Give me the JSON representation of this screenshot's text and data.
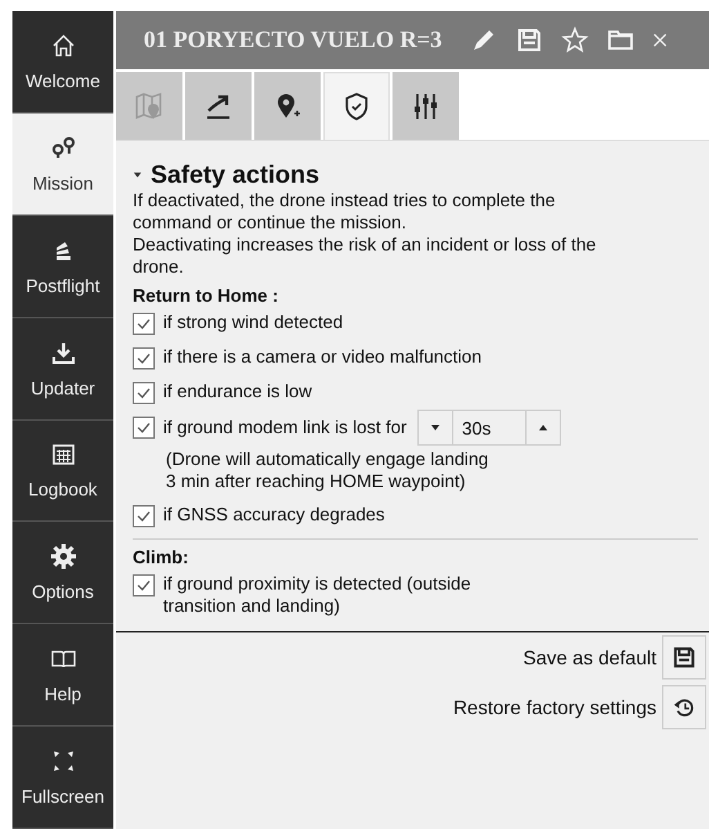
{
  "sidebar": {
    "items": [
      {
        "label": "Welcome",
        "selected": false
      },
      {
        "label": "Mission",
        "selected": true
      },
      {
        "label": "Postflight",
        "selected": false
      },
      {
        "label": "Updater",
        "selected": false
      },
      {
        "label": "Logbook",
        "selected": false
      },
      {
        "label": "Options",
        "selected": false
      },
      {
        "label": "Help",
        "selected": false
      },
      {
        "label": "Fullscreen",
        "selected": false
      }
    ]
  },
  "window": {
    "title": "01 PORYECTO VUELO R=3"
  },
  "tabs": [
    {
      "selected": false,
      "disabled": true
    },
    {
      "selected": false,
      "disabled": false
    },
    {
      "selected": false,
      "disabled": false
    },
    {
      "selected": true,
      "disabled": false
    },
    {
      "selected": false,
      "disabled": false
    }
  ],
  "panel": {
    "title": "Safety actions",
    "expanded": true,
    "description": [
      "If deactivated, the drone instead tries to complete the command or continue the mission.",
      "Deactivating increases the risk of an incident or loss of the drone."
    ],
    "sections": [
      {
        "title": "Return to Home :",
        "items": [
          {
            "label": "if strong wind detected",
            "checked": true
          },
          {
            "label": "if there is a camera or video malfunction",
            "checked": true
          },
          {
            "label": "if endurance is low",
            "checked": true
          },
          {
            "label": "if ground modem link is lost for",
            "checked": true,
            "stepper": "30s",
            "note": [
              "(Drone will automatically engage landing",
              "3 min after reaching HOME waypoint)"
            ]
          },
          {
            "label": "if GNSS accuracy degrades",
            "checked": true
          }
        ]
      },
      {
        "title": "Climb:",
        "items": [
          {
            "label": "if ground proximity is detected (outside transition and landing)",
            "checked": true
          }
        ]
      }
    ]
  },
  "actions": [
    {
      "label": "Save as default"
    },
    {
      "label": "Restore factory settings"
    }
  ]
}
